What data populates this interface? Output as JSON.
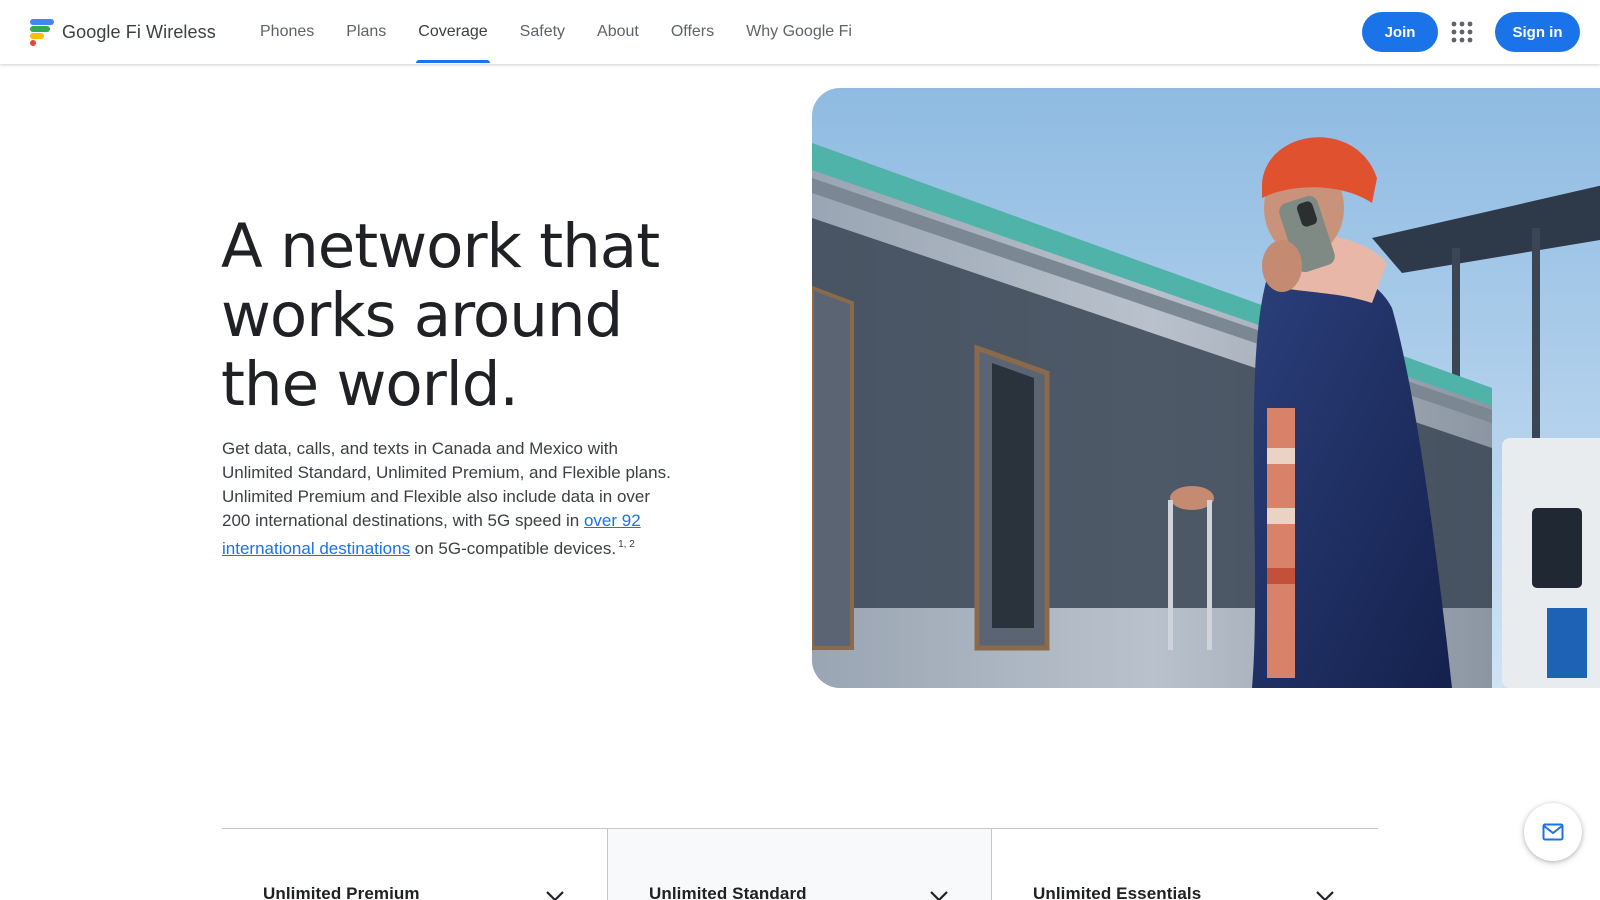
{
  "header": {
    "brand": "Google Fi Wireless",
    "nav": [
      {
        "label": "Phones"
      },
      {
        "label": "Plans"
      },
      {
        "label": "Coverage",
        "active": true
      },
      {
        "label": "Safety"
      },
      {
        "label": "About"
      },
      {
        "label": "Offers"
      },
      {
        "label": "Why Google Fi"
      }
    ],
    "join_label": "Join",
    "signin_label": "Sign in",
    "apps_icon": "apps-grid-icon"
  },
  "hero": {
    "title_lines": [
      "A network that",
      "works around",
      "the world."
    ],
    "body_text_1": "Get data, calls, and texts in Canada and Mexico with Unlimited Standard, Unlimited Premium, and Flexible plans. Unlimited Premium and Flexible also include data in over 200 international destinations, with 5G speed in ",
    "body_link": "over 92 international destinations",
    "body_text_2": " on 5G-compatible devices.",
    "footnote": "1, 2"
  },
  "plans": {
    "tabs": [
      {
        "label": "Unlimited Premium"
      },
      {
        "label": "Unlimited Standard",
        "selected": true
      },
      {
        "label": "Unlimited Essentials"
      }
    ]
  },
  "colors": {
    "accent": "#1a73e8",
    "text": "#202124",
    "muted": "#5f6368"
  },
  "icons": {
    "mail": "mail-icon",
    "chevron": "chevron-down-icon"
  }
}
